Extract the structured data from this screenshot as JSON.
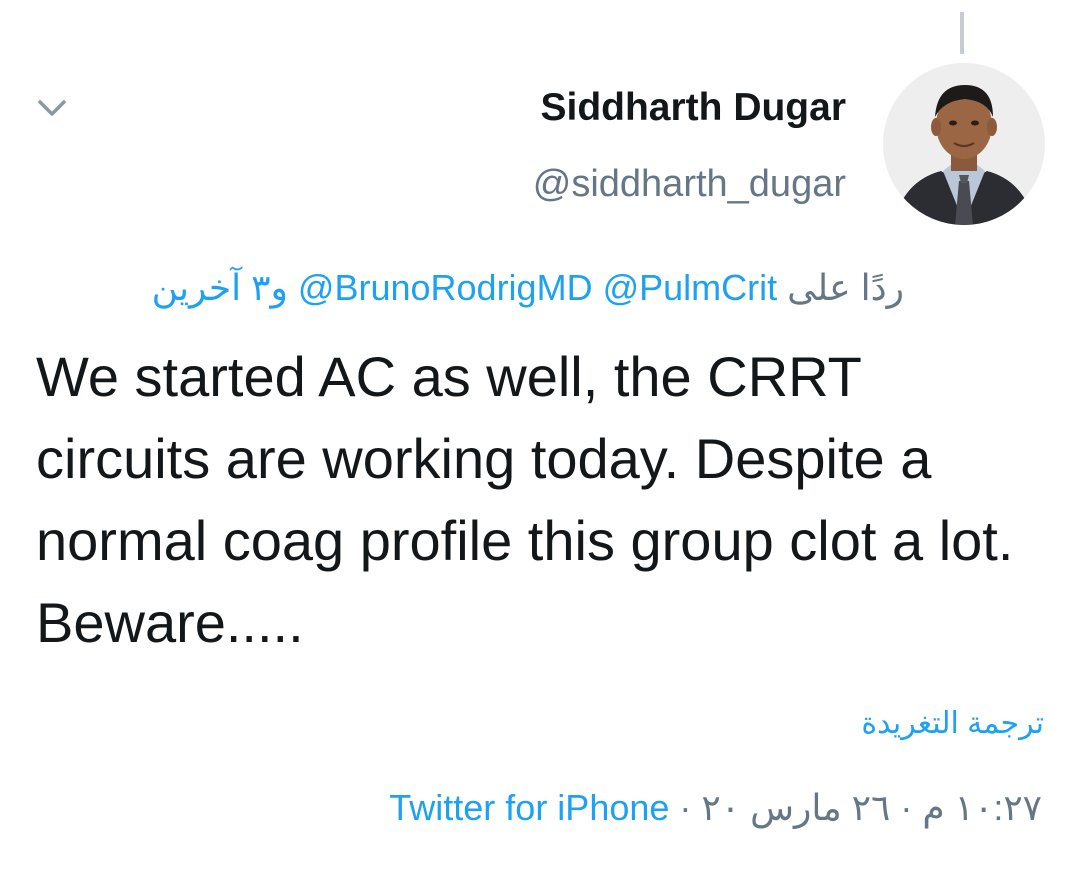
{
  "author": {
    "name": "Siddharth Dugar",
    "handle": "@siddharth_dugar"
  },
  "reply": {
    "prefix": "ردًا على",
    "mentions": [
      "@PulmCrit",
      "@BrunoRodrigMD"
    ],
    "others": "و٣ آخرين"
  },
  "tweet": {
    "text": "We started AC as well, the CRRT circuits are working today. Despite a normal coag profile this group clot a lot. Beware....."
  },
  "actions": {
    "translate_label": "ترجمة التغريدة"
  },
  "meta": {
    "time": "١٠:٢٧ م",
    "separator": "·",
    "date": "٢٦ مارس ٢٠",
    "source": "Twitter for iPhone"
  },
  "icons": {
    "chevron": "chevron-down-icon",
    "avatar": "avatar"
  },
  "colors": {
    "link": "#1da1f2",
    "secondary_text": "#657786",
    "primary_text": "#14171a"
  }
}
